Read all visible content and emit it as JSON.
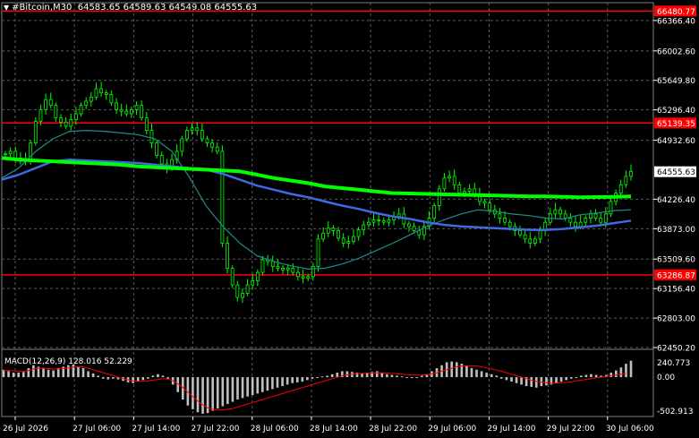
{
  "header": {
    "symbol_text": "#Bitcoin,M30",
    "ohlc_text": "64583.65 64589.63 64549.08 64555.63"
  },
  "colors": {
    "background": "#000000",
    "grid": "#5a5a5a",
    "candle": "#00ff00",
    "level_line": "#ff0000",
    "level_label_bg": "#ff0000",
    "ma_slow": "#00ff00",
    "ma_mid": "#4169e1",
    "ma_fast": "#1e8c8c",
    "price_label_bg": "#ffffff",
    "macd_hist": "#c0c0c0",
    "macd_signal": "#ff0000"
  },
  "chart_data": {
    "type": "candlestick",
    "y_ticks": [
      "66366.40",
      "66002.60",
      "65649.80",
      "65296.40",
      "64932.60",
      "64226.40",
      "63873.00",
      "63509.60",
      "63156.40",
      "62803.00",
      "62450.20"
    ],
    "current_price_label": "64555.63",
    "levels": [
      {
        "value": 66480.7,
        "label": "66480.77"
      },
      {
        "value": 65139.3,
        "label": "65139.35"
      },
      {
        "value": 63320.8,
        "label": "63286.87"
      }
    ],
    "x_labels": [
      "26 Jul 2026",
      "27 Jul 06:00",
      "27 Jul 14:00",
      "27 Jul 22:00",
      "28 Jul 06:00",
      "28 Jul 14:00",
      "28 Jul 22:00",
      "29 Jul 06:00",
      "29 Jul 14:00",
      "29 Jul 22:00",
      "30 Jul 06:00"
    ],
    "y_range": [
      62450.2,
      66580
    ],
    "closes": [
      64770,
      64800,
      64720,
      64680,
      64700,
      64900,
      65160,
      65300,
      65420,
      65350,
      65200,
      65150,
      65100,
      65180,
      65250,
      65350,
      65400,
      65450,
      65550,
      65500,
      65480,
      65380,
      65300,
      65280,
      65250,
      65300,
      65350,
      65200,
      65050,
      64900,
      64750,
      64650,
      64600,
      64700,
      64800,
      64950,
      65050,
      65080,
      65050,
      64950,
      64900,
      64850,
      64800,
      63700,
      63400,
      63200,
      63050,
      63100,
      63200,
      63250,
      63350,
      63500,
      63480,
      63420,
      63400,
      63380,
      63400,
      63350,
      63300,
      63280,
      63300,
      63420,
      63750,
      63820,
      63880,
      63850,
      63760,
      63700,
      63720,
      63780,
      63860,
      63920,
      63950,
      63980,
      63970,
      63950,
      63980,
      64020,
      64050,
      63930,
      63900,
      63850,
      63800,
      63900,
      64000,
      64150,
      64350,
      64480,
      64500,
      64400,
      64300,
      64320,
      64350,
      64280,
      64200,
      64180,
      64100,
      64050,
      64000,
      63950,
      63900,
      63850,
      63800,
      63750,
      63700,
      63750,
      63850,
      63950,
      64050,
      64100,
      64050,
      64000,
      63950,
      63900,
      63950,
      64000,
      64050,
      64000,
      63950,
      64050,
      64200,
      64300,
      64400,
      64500,
      64560
    ],
    "ma_slow": [
      64720,
      64700,
      64690,
      64680,
      64670,
      64660,
      64650,
      64640,
      64620,
      64610,
      64600,
      64590,
      64580,
      64570,
      64560,
      64520,
      64480,
      64450,
      64420,
      64380,
      64360,
      64340,
      64320,
      64300,
      64295,
      64290,
      64285,
      64280,
      64275,
      64270,
      64265,
      64260,
      64260,
      64255,
      64250,
      64252,
      64255,
      64260
    ],
    "ma_mid": [
      64460,
      64520,
      64600,
      64680,
      64700,
      64690,
      64680,
      64670,
      64660,
      64640,
      64620,
      64600,
      64580,
      64530,
      64460,
      64390,
      64340,
      64290,
      64250,
      64200,
      64150,
      64110,
      64060,
      64020,
      63990,
      63950,
      63920,
      63900,
      63890,
      63880,
      63870,
      63860,
      63860,
      63870,
      63890,
      63910,
      63940,
      63970
    ],
    "ma_fast": [
      64480,
      64600,
      64800,
      64950,
      65040,
      65050,
      65040,
      65020,
      65000,
      64950,
      64800,
      64500,
      64150,
      63900,
      63700,
      63550,
      63480,
      63430,
      63390,
      63400,
      63450,
      63520,
      63610,
      63700,
      63800,
      63900,
      63980,
      64050,
      64100,
      64080,
      64050,
      64030,
      64000,
      63990,
      64040,
      64060,
      64090,
      64100
    ],
    "macd_labels": [
      "MACD(12,26,9) 128.016 52.229",
      "240.773",
      "0.00",
      "-502.913"
    ],
    "macd_hist": [
      100,
      80,
      60,
      60,
      70,
      120,
      160,
      140,
      120,
      100,
      90,
      120,
      140,
      160,
      170,
      140,
      120,
      80,
      50,
      20,
      -20,
      -30,
      -20,
      -30,
      -50,
      -70,
      -80,
      -60,
      -40,
      -20,
      20,
      40,
      20,
      -20,
      -100,
      -200,
      -300,
      -380,
      -430,
      -470,
      -490,
      -480,
      -450,
      -420,
      -390,
      -360,
      -330,
      -300,
      -280,
      -260,
      -240,
      -220,
      -200,
      -180,
      -160,
      -140,
      -120,
      -100,
      -80,
      -70,
      -60,
      -40,
      -20,
      0,
      10,
      20,
      40,
      60,
      80,
      80,
      70,
      60,
      50,
      60,
      70,
      80,
      60,
      40,
      30,
      20,
      10,
      0,
      -10,
      0,
      20,
      40,
      80,
      120,
      160,
      200,
      210,
      200,
      180,
      150,
      120,
      100,
      80,
      60,
      40,
      20,
      -20,
      -40,
      -60,
      -80,
      -100,
      -120,
      -130,
      -140,
      -120,
      -110,
      -100,
      -80,
      -60,
      -40,
      -20,
      0,
      20,
      30,
      40,
      30,
      20,
      30,
      60,
      90,
      130,
      180,
      220
    ],
    "macd_signal": [
      90,
      90,
      85,
      80,
      75,
      90,
      110,
      120,
      120,
      115,
      110,
      110,
      115,
      125,
      135,
      140,
      135,
      120,
      100,
      80,
      60,
      40,
      20,
      0,
      -20,
      -35,
      -50,
      -55,
      -55,
      -50,
      -40,
      -30,
      -20,
      -25,
      -50,
      -90,
      -140,
      -200,
      -260,
      -320,
      -370,
      -410,
      -430,
      -440,
      -440,
      -430,
      -420,
      -400,
      -380,
      -360,
      -340,
      -320,
      -300,
      -280,
      -260,
      -240,
      -220,
      -200,
      -180,
      -160,
      -140,
      -120,
      -100,
      -80,
      -60,
      -40,
      -20,
      0,
      20,
      30,
      40,
      45,
      50,
      52,
      55,
      58,
      58,
      55,
      50,
      45,
      40,
      35,
      30,
      28,
      30,
      35,
      45,
      60,
      80,
      100,
      120,
      140,
      150,
      155,
      155,
      150,
      140,
      125,
      110,
      95,
      80,
      60,
      40,
      20,
      0,
      -20,
      -40,
      -55,
      -65,
      -75,
      -80,
      -80,
      -75,
      -70,
      -60,
      -50,
      -40,
      -30,
      -20,
      -10,
      0,
      10,
      20,
      30,
      40,
      52
    ]
  }
}
